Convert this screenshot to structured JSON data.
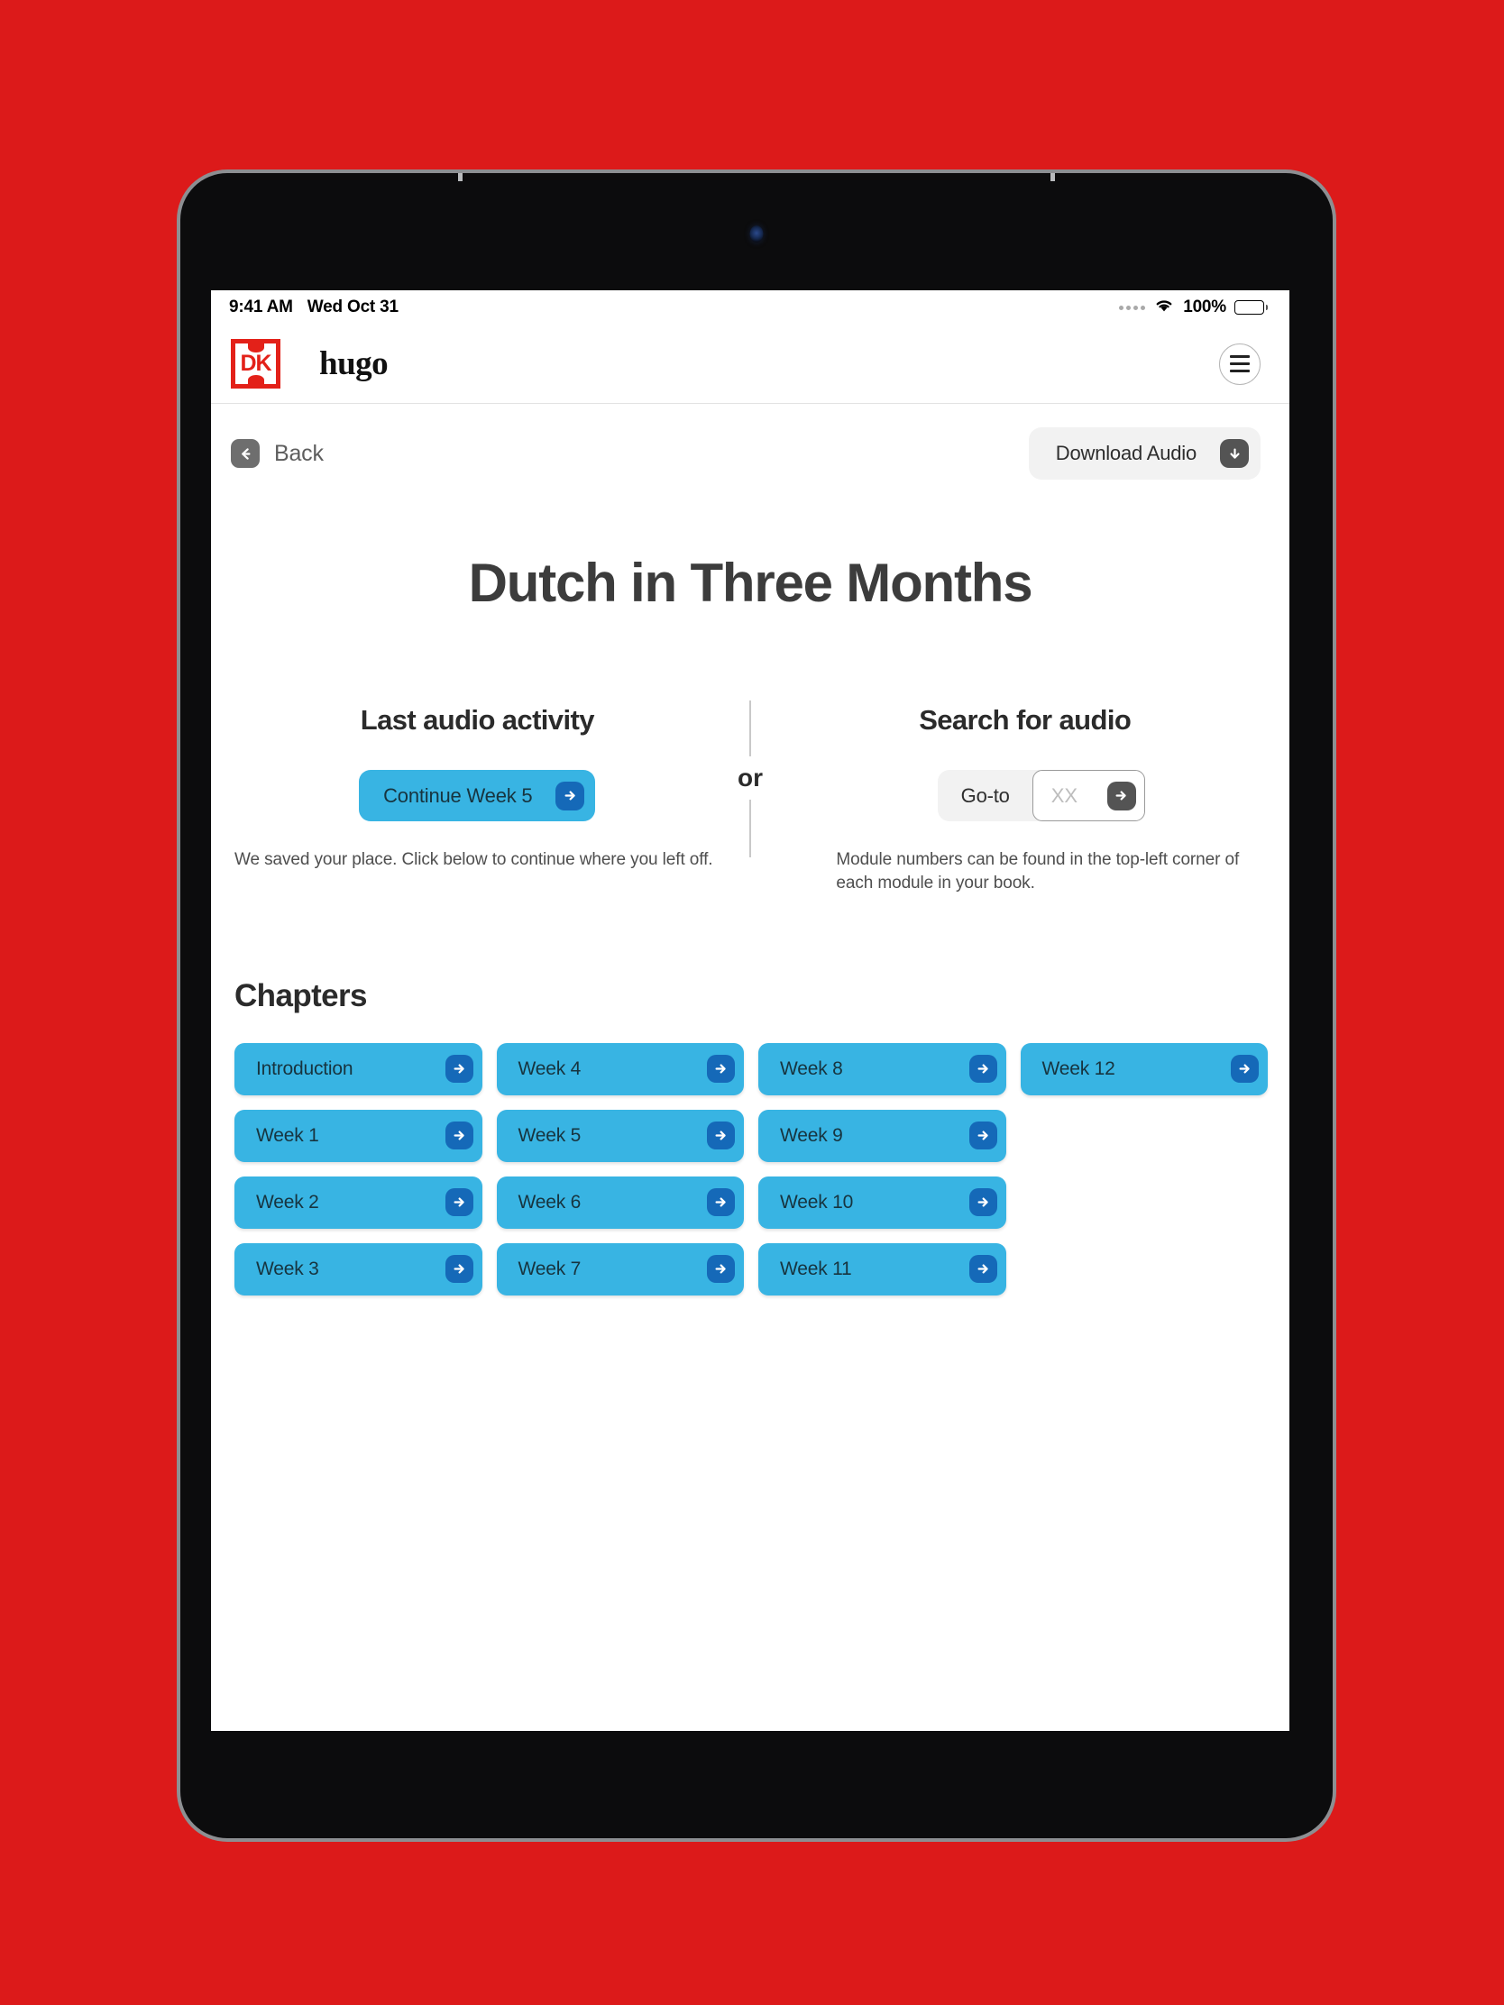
{
  "status_bar": {
    "time": "9:41 AM",
    "date": "Wed Oct 31",
    "battery_percent": "100%",
    "wifi_icon": "wifi-icon",
    "battery_icon": "battery-icon"
  },
  "header": {
    "logo_text": "DK",
    "brand_word": "hugo",
    "menu_icon": "hamburger-menu-icon"
  },
  "toolbar": {
    "back_label": "Back",
    "back_icon": "arrow-left-icon",
    "download_label": "Download Audio",
    "download_icon": "arrow-down-icon"
  },
  "page": {
    "title": "Dutch in Three Months"
  },
  "last_activity": {
    "heading": "Last audio activity",
    "continue_label": "Continue Week 5",
    "continue_icon": "arrow-right-icon",
    "description": "We saved your place. Click below to continue where you left off."
  },
  "divider": {
    "or_label": "or"
  },
  "search_audio": {
    "heading": "Search for audio",
    "goto_label": "Go-to",
    "input_value": "",
    "input_placeholder": "XX",
    "submit_icon": "arrow-right-icon",
    "description": "Module numbers can be found in the top-left corner of each module in your book."
  },
  "chapters": {
    "heading": "Chapters",
    "items": [
      {
        "label": "Introduction",
        "icon": "arrow-right-icon"
      },
      {
        "label": "Week 1",
        "icon": "arrow-right-icon"
      },
      {
        "label": "Week 2",
        "icon": "arrow-right-icon"
      },
      {
        "label": "Week 3",
        "icon": "arrow-right-icon"
      },
      {
        "label": "Week 4",
        "icon": "arrow-right-icon"
      },
      {
        "label": "Week 5",
        "icon": "arrow-right-icon"
      },
      {
        "label": "Week 6",
        "icon": "arrow-right-icon"
      },
      {
        "label": "Week 7",
        "icon": "arrow-right-icon"
      },
      {
        "label": "Week 8",
        "icon": "arrow-right-icon"
      },
      {
        "label": "Week 9",
        "icon": "arrow-right-icon"
      },
      {
        "label": "Week 10",
        "icon": "arrow-right-icon"
      },
      {
        "label": "Week 11",
        "icon": "arrow-right-icon"
      },
      {
        "label": "Week 12",
        "icon": "arrow-right-icon"
      }
    ]
  },
  "colors": {
    "background_red": "#DC1A1A",
    "brand_red": "#E32119",
    "accent_blue": "#38B4E3",
    "icon_blue": "#1569B8",
    "grey_chip": "#F2F2F2",
    "icon_grey": "#6E6E6E"
  }
}
